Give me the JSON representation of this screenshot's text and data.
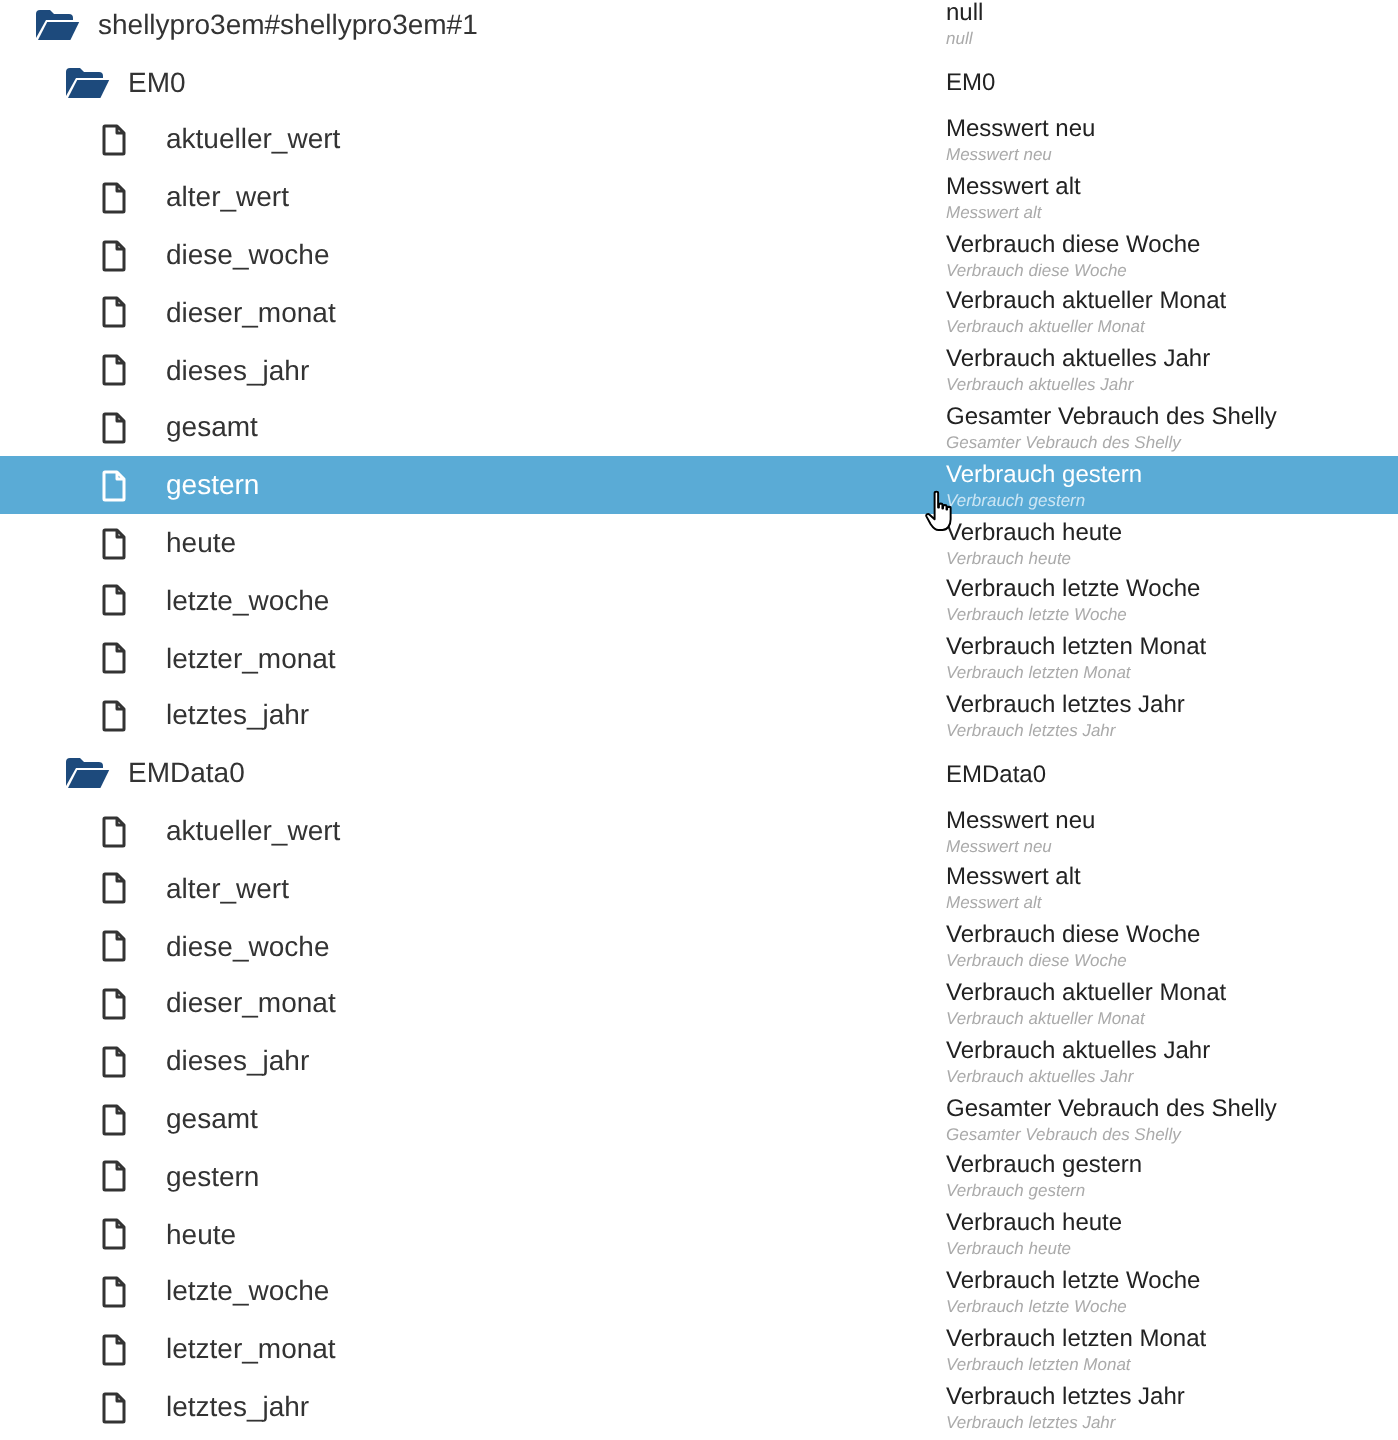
{
  "tree": [
    {
      "kind": "folder",
      "name": "shellypro3em#shellypro3em#1",
      "title": "null",
      "description": "null",
      "expanded": true,
      "selected": false,
      "children": [
        {
          "kind": "folder",
          "name": "EM0",
          "title": "EM0",
          "expanded": true,
          "selected": false,
          "children": [
            {
              "kind": "state",
              "name": "aktueller_wert",
              "title": "Messwert neu",
              "description": "Messwert neu",
              "selected": false
            },
            {
              "kind": "state",
              "name": "alter_wert",
              "title": "Messwert alt",
              "description": "Messwert alt",
              "selected": false
            },
            {
              "kind": "state",
              "name": "diese_woche",
              "title": "Verbrauch diese Woche",
              "description": "Verbrauch diese Woche",
              "selected": false
            },
            {
              "kind": "state",
              "name": "dieser_monat",
              "title": "Verbrauch aktueller Monat",
              "description": "Verbrauch aktueller Monat",
              "selected": false
            },
            {
              "kind": "state",
              "name": "dieses_jahr",
              "title": "Verbrauch aktuelles Jahr",
              "description": "Verbrauch aktuelles Jahr",
              "selected": false
            },
            {
              "kind": "state",
              "name": "gesamt",
              "title": "Gesamter Vebrauch des Shelly",
              "description": "Gesamter Vebrauch des Shelly",
              "selected": false
            },
            {
              "kind": "state",
              "name": "gestern",
              "title": "Verbrauch gestern",
              "description": "Verbrauch gestern",
              "selected": true
            },
            {
              "kind": "state",
              "name": "heute",
              "title": "Verbrauch heute",
              "description": "Verbrauch heute",
              "selected": false
            },
            {
              "kind": "state",
              "name": "letzte_woche",
              "title": "Verbrauch letzte Woche",
              "description": "Verbrauch letzte Woche",
              "selected": false
            },
            {
              "kind": "state",
              "name": "letzter_monat",
              "title": "Verbrauch letzten Monat",
              "description": "Verbrauch letzten Monat",
              "selected": false
            },
            {
              "kind": "state",
              "name": "letztes_jahr",
              "title": "Verbrauch letztes Jahr",
              "description": "Verbrauch letztes Jahr",
              "selected": false
            }
          ]
        },
        {
          "kind": "folder",
          "name": "EMData0",
          "title": "EMData0",
          "expanded": true,
          "selected": false,
          "children": [
            {
              "kind": "state",
              "name": "aktueller_wert",
              "title": "Messwert neu",
              "description": "Messwert neu",
              "selected": false
            },
            {
              "kind": "state",
              "name": "alter_wert",
              "title": "Messwert alt",
              "description": "Messwert alt",
              "selected": false
            },
            {
              "kind": "state",
              "name": "diese_woche",
              "title": "Verbrauch diese Woche",
              "description": "Verbrauch diese Woche",
              "selected": false
            },
            {
              "kind": "state",
              "name": "dieser_monat",
              "title": "Verbrauch aktueller Monat",
              "description": "Verbrauch aktueller Monat",
              "selected": false
            },
            {
              "kind": "state",
              "name": "dieses_jahr",
              "title": "Verbrauch aktuelles Jahr",
              "description": "Verbrauch aktuelles Jahr",
              "selected": false
            },
            {
              "kind": "state",
              "name": "gesamt",
              "title": "Gesamter Vebrauch des Shelly",
              "description": "Gesamter Vebrauch des Shelly",
              "selected": false
            },
            {
              "kind": "state",
              "name": "gestern",
              "title": "Verbrauch gestern",
              "description": "Verbrauch gestern",
              "selected": false
            },
            {
              "kind": "state",
              "name": "heute",
              "title": "Verbrauch heute",
              "description": "Verbrauch heute",
              "selected": false
            },
            {
              "kind": "state",
              "name": "letzte_woche",
              "title": "Verbrauch letzte Woche",
              "description": "Verbrauch letzte Woche",
              "selected": false
            },
            {
              "kind": "state",
              "name": "letzter_monat",
              "title": "Verbrauch letzten Monat",
              "description": "Verbrauch letzten Monat",
              "selected": false
            },
            {
              "kind": "state",
              "name": "letztes_jahr",
              "title": "Verbrauch letztes Jahr",
              "description": "Verbrauch letztes Jahr",
              "selected": false
            }
          ]
        }
      ]
    }
  ]
}
